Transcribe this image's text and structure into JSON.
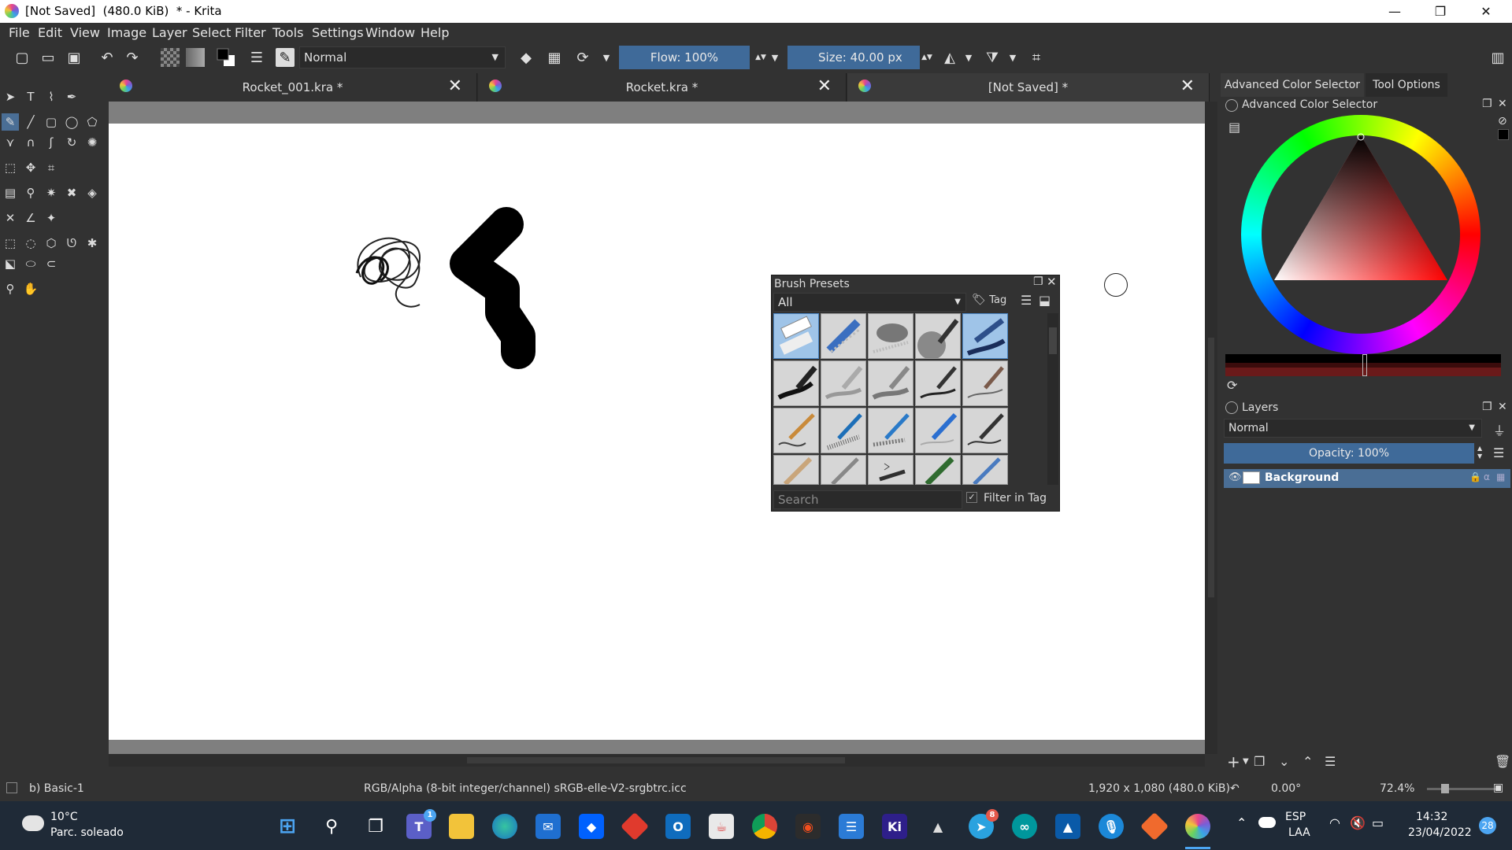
{
  "window": {
    "title": "[Not Saved]  (480.0 KiB)  * - Krita",
    "minimize": "—",
    "restore": "❐",
    "close": "✕"
  },
  "menu": [
    "File",
    "Edit",
    "View",
    "Image",
    "Layer",
    "Select",
    "Filter",
    "Tools",
    "Settings",
    "Window",
    "Help"
  ],
  "toolbar": {
    "blend_mode": "Normal",
    "flow": "Flow: 100%",
    "size": "Size: 40.00 px"
  },
  "tabs": [
    {
      "label": "Rocket_001.kra *",
      "close": "✕"
    },
    {
      "label": "Rocket.kra *",
      "close": "✕"
    },
    {
      "label": "[Not Saved]  *",
      "close": "✕"
    }
  ],
  "right_tabs": [
    "Advanced Color Selector",
    "Tool Options"
  ],
  "color_selector": {
    "title": "Advanced Color Selector"
  },
  "layers": {
    "title": "Layers",
    "blend_mode": "Normal",
    "opacity": "Opacity:  100%",
    "items": [
      {
        "name": "Background"
      }
    ]
  },
  "brush_presets": {
    "title": "Brush Presets",
    "filter": "All",
    "tag": "Tag",
    "search_placeholder": "Search",
    "filter_in_tag": "Filter in Tag",
    "checked": "✓"
  },
  "status": {
    "brush": "b) Basic-1",
    "color_model": "RGB/Alpha (8-bit integer/channel)  sRGB-elle-V2-srgbtrc.icc",
    "dimensions": "1,920 x 1,080 (480.0 KiB)",
    "rotation": "0.00°",
    "zoom": "72.4%"
  },
  "taskbar": {
    "weather_temp": "10°C",
    "weather_desc": "Parc. soleado",
    "lang": "ESP",
    "lang2": "LAA",
    "time": "14:32",
    "date": "23/04/2022",
    "notifications": "28",
    "teams_badge": "1",
    "telegram_badge": "8",
    "krita_label": "Ki"
  },
  "colors": {
    "accent": "#4a6e95",
    "panel": "#323232",
    "canvas": "#ffffff",
    "taskbar": "#1f2a37"
  }
}
